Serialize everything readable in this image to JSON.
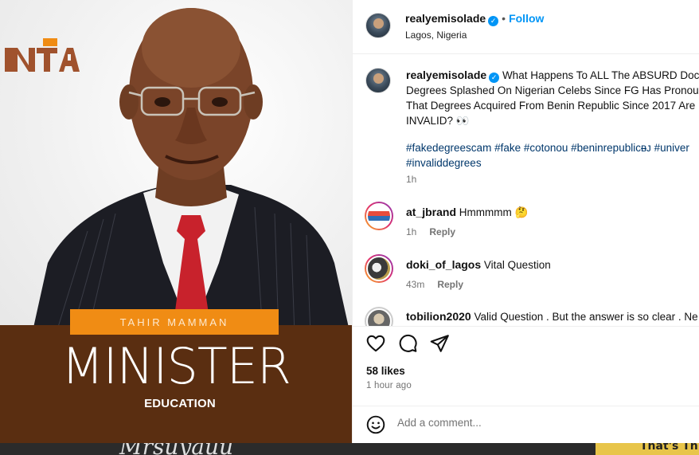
{
  "image": {
    "logo_text": "NTA",
    "name_tag": "TAHIR MAMMAN",
    "headline": "MINISTER",
    "department": "EDUCATION",
    "strip_left_text": "Mrsuyauu",
    "strip_right_text": "That's Th"
  },
  "header": {
    "username": "realyemisolade",
    "verified": "✓",
    "separator": "•",
    "follow_label": "Follow",
    "location": "Lagos, Nigeria"
  },
  "caption": {
    "username": "realyemisolade",
    "text_line1": "What Happens To ALL The ABSURD Docto",
    "text_line2": "Degrees Splashed On Nigerian Celebs Since FG Has Pronoun",
    "text_line3": "That Degrees Acquired From Benin Republic Since 2017 Are",
    "text_line4": "INVALID? 👀",
    "hashtags_line1": "#fakedegreescam #fake #cotonou #beninrepublicᴃᴊ #univer",
    "hashtags_line2": "#invaliddegrees",
    "time": "1h"
  },
  "comments": [
    {
      "username": "at_jbrand",
      "text": "Hmmmmm 🤔",
      "time": "1h",
      "reply": "Reply"
    },
    {
      "username": "doki_of_lagos",
      "text": "Vital Question",
      "time": "43m",
      "reply": "Reply"
    },
    {
      "username": "tobilion2020",
      "text": "Valid Question . But the answer is so clear . Ne"
    }
  ],
  "actions": {
    "likes": "58 likes",
    "time_ago": "1 hour ago"
  },
  "comment_input": {
    "placeholder": "Add a comment..."
  },
  "colors": {
    "accent_blue": "#0095f6",
    "hashtag_blue": "#00376b",
    "band_brown": "#5a2e11",
    "tag_orange": "#f08c14"
  }
}
